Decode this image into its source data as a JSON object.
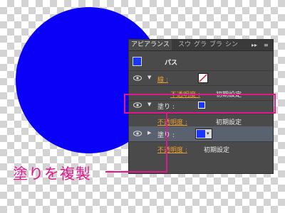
{
  "canvas": {
    "shape": "circle",
    "fill_color": "#0a00f5"
  },
  "panel": {
    "tabs": [
      {
        "label": "アピアランス",
        "active": true
      },
      {
        "label": "スウ",
        "active": false
      },
      {
        "label": "グラ",
        "active": false
      },
      {
        "label": "ブラ",
        "active": false
      },
      {
        "label": "シン",
        "active": false
      }
    ],
    "tab_menu_glyph": "▸▸",
    "panel_menu_glyph": "≡",
    "object": {
      "label": "パス",
      "thumb_color": "#1a35ff"
    },
    "rows": [
      {
        "label": "線 :",
        "label_style": "orange",
        "swatch": "stroke-none",
        "expanded": true
      },
      {
        "label": "不透明度 :",
        "value": "初期設定",
        "label_style": "orange"
      },
      {
        "label": "塗り :",
        "label_style": "white",
        "swatch_color": "#1a35ff",
        "expanded": true
      },
      {
        "label": "不透明度 :",
        "value": "初期設定",
        "label_style": "orange"
      },
      {
        "label": "塗り :",
        "label_style": "white",
        "swatch_color": "#1a35ff",
        "expanded": false
      },
      {
        "label": "不透明度 :",
        "value": "初期設定",
        "label_style": "orange"
      }
    ]
  },
  "annotation": {
    "text": "塗りを複製",
    "color": "#e0188a"
  }
}
